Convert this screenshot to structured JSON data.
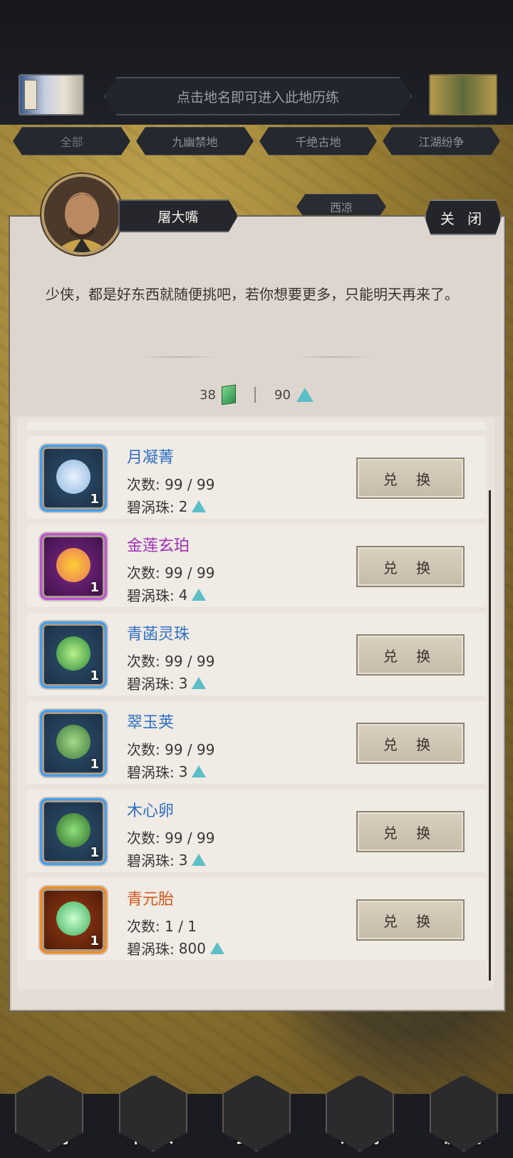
{
  "header": {
    "title_hint": "点击地名即可进入此地历练"
  },
  "filter_tabs": [
    "全部",
    "九幽禁地",
    "千绝古地",
    "江湖纷争"
  ],
  "map": {
    "location_label": "西凉"
  },
  "dialog": {
    "npc_name": "屠大嘴",
    "close_label": "关 闭",
    "message": "少侠，都是好东西就随便挑吧，若你想要更多，只能明天再来了。",
    "currency": {
      "jade_amount": "38",
      "pearl_amount": "90"
    }
  },
  "items": [
    {
      "name": "月凝菁",
      "name_color": "#2f6fc4",
      "count_label": "次数: ",
      "count": "99 / 99",
      "cost_label": "碧涡珠: ",
      "cost": "2",
      "qty": "1",
      "rarity": "blue",
      "icon": "silver-herb-icon",
      "button": "兑 换"
    },
    {
      "name": "金莲玄珀",
      "name_color": "#a12fb3",
      "count_label": "次数: ",
      "count": "99 / 99",
      "cost_label": "碧涡珠: ",
      "cost": "4",
      "qty": "1",
      "rarity": "purple",
      "icon": "golden-lotus-icon",
      "button": "兑 换"
    },
    {
      "name": "青菡灵珠",
      "name_color": "#2f6fc4",
      "count_label": "次数: ",
      "count": "99 / 99",
      "cost_label": "碧涡珠: ",
      "cost": "3",
      "qty": "1",
      "rarity": "blue",
      "icon": "green-pearl-icon",
      "button": "兑 换"
    },
    {
      "name": "翠玉荚",
      "name_color": "#2f6fc4",
      "count_label": "次数: ",
      "count": "99 / 99",
      "cost_label": "碧涡珠: ",
      "cost": "3",
      "qty": "1",
      "rarity": "blue",
      "icon": "pea-pod-icon",
      "button": "兑 换"
    },
    {
      "name": "木心卵",
      "name_color": "#2f6fc4",
      "count_label": "次数: ",
      "count": "99 / 99",
      "cost_label": "碧涡珠: ",
      "cost": "3",
      "qty": "1",
      "rarity": "blue",
      "icon": "wood-egg-icon",
      "button": "兑 换"
    },
    {
      "name": "青元胎",
      "name_color": "#d2581c",
      "count_label": "次数: ",
      "count": "1 / 1",
      "cost_label": "碧涡珠: ",
      "cost": "800",
      "qty": "1",
      "rarity": "orange",
      "icon": "green-embryo-icon",
      "button": "兑 换"
    }
  ],
  "bottom_nav": [
    "吐纳",
    "门派",
    "武学",
    "江湖",
    "游历"
  ],
  "colors": {
    "accent_blue": "#2f6fc4",
    "pearl": "#5bbfc7"
  }
}
